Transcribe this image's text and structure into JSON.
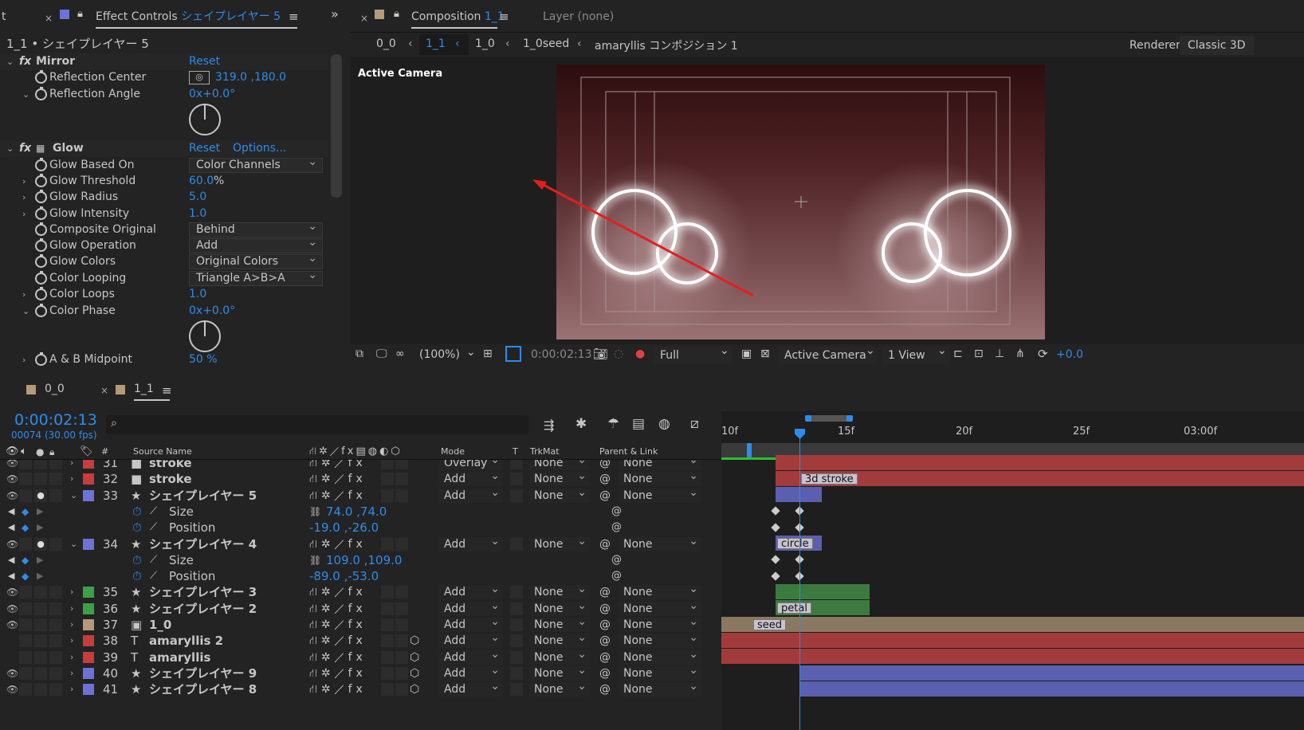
{
  "effect_controls": {
    "tab_close": "×",
    "tab_title": "Effect Controls",
    "tab_layer": "シェイプレイヤー 5",
    "layer_path": "1_1 • シェイプレイヤー 5",
    "mirror": {
      "name": "Mirror",
      "reset": "Reset",
      "props": [
        {
          "label": "Reflection Center",
          "value": "319.0 ,180.0"
        },
        {
          "label": "Reflection Angle",
          "value": "0x+0.0°"
        }
      ]
    },
    "glow": {
      "name": "Glow",
      "reset": "Reset",
      "options": "Options...",
      "props": [
        {
          "label": "Glow Based On",
          "value": "Color Channels",
          "kind": "dropdown"
        },
        {
          "label": "Glow Threshold",
          "value": "60.0",
          "unit": "%",
          "kind": "num"
        },
        {
          "label": "Glow Radius",
          "value": "5.0",
          "kind": "num"
        },
        {
          "label": "Glow Intensity",
          "value": "1.0",
          "kind": "num"
        },
        {
          "label": "Composite Original",
          "value": "Behind",
          "kind": "dropdown"
        },
        {
          "label": "Glow Operation",
          "value": "Add",
          "kind": "dropdown"
        },
        {
          "label": "Glow Colors",
          "value": "Original Colors",
          "kind": "dropdown"
        },
        {
          "label": "Color Looping",
          "value": "Triangle A>B>A",
          "kind": "dropdown"
        },
        {
          "label": "Color Loops",
          "value": "1.0",
          "kind": "num"
        },
        {
          "label": "Color Phase",
          "value": "0x+0.0°",
          "kind": "num"
        },
        {
          "label": "A & B Midpoint",
          "value": "50 %",
          "kind": "num"
        }
      ]
    }
  },
  "composition": {
    "tab_close": "×",
    "tab_title": "Composition",
    "tab_name": "1_1",
    "layer_tab": "Layer (none)",
    "breadcrumbs": [
      "0_0",
      "1_1",
      "1_0",
      "1_0seed",
      "amaryllis コンポジション 1"
    ],
    "renderer_label": "Renderer:",
    "renderer_value": "Classic 3D",
    "view_label": "Active Camera",
    "footer": {
      "zoom": "(100%)",
      "timecode": "0:00:02:13",
      "resolution": "Full",
      "camera": "Active Camera",
      "views": "1 View",
      "exposure": "+0.0"
    }
  },
  "timeline": {
    "tabs": [
      {
        "label": "0_0"
      },
      {
        "label": "1_1"
      }
    ],
    "tab_close": "×",
    "timecode": "0:00:02:13",
    "frame_info": "00074 (30.00 fps)",
    "search_placeholder": "",
    "col_headers": {
      "num": "#",
      "source": "Source Name",
      "mode": "Mode",
      "t": "T",
      "trkmat": "TrkMat",
      "parent": "Parent & Link"
    },
    "ruler": [
      "10f",
      "15f",
      "20f",
      "25f",
      "03:00f"
    ],
    "layers": [
      {
        "num": "31",
        "color": "#c83c3c",
        "icon": "■",
        "name": "stroke",
        "mode": "Overlay",
        "trk": "None",
        "parent": "None"
      },
      {
        "num": "32",
        "color": "#c83c3c",
        "icon": "■",
        "name": "stroke",
        "mode": "Add",
        "trk": "None",
        "parent": "None"
      },
      {
        "num": "33",
        "color": "#6c72d8",
        "icon": "★",
        "name": "シェイプレイヤー 5",
        "mode": "Add",
        "trk": "None",
        "parent": "None"
      },
      {
        "sub": true,
        "name": "Size",
        "value": "74.0 ,74.0"
      },
      {
        "sub": true,
        "name": "Position",
        "value": "-19.0 ,-26.0"
      },
      {
        "num": "34",
        "color": "#6c72d8",
        "icon": "★",
        "name": "シェイプレイヤー 4",
        "mode": "Add",
        "trk": "None",
        "parent": "None"
      },
      {
        "sub": true,
        "name": "Size",
        "value": "109.0 ,109.0"
      },
      {
        "sub": true,
        "name": "Position",
        "value": "-89.0 ,-53.0"
      },
      {
        "num": "35",
        "color": "#3ca046",
        "icon": "★",
        "name": "シェイプレイヤー 3",
        "mode": "Add",
        "trk": "None",
        "parent": "None"
      },
      {
        "num": "36",
        "color": "#3ca046",
        "icon": "★",
        "name": "シェイプレイヤー 2",
        "mode": "Add",
        "trk": "None",
        "parent": "None"
      },
      {
        "num": "37",
        "color": "#b49a78",
        "icon": "▣",
        "name": "1_0",
        "mode": "Add",
        "trk": "None",
        "parent": "None"
      },
      {
        "num": "38",
        "color": "#c83c3c",
        "icon": "T",
        "name": "amaryllis 2",
        "mode": "Add",
        "trk": "None",
        "parent": "None"
      },
      {
        "num": "39",
        "color": "#c83c3c",
        "icon": "T",
        "name": "amaryllis",
        "mode": "Add",
        "trk": "None",
        "parent": "None"
      },
      {
        "num": "40",
        "color": "#6c72d8",
        "icon": "★",
        "name": "シェイプレイヤー 9",
        "mode": "Add",
        "trk": "None",
        "parent": "None"
      },
      {
        "num": "41",
        "color": "#6c72d8",
        "icon": "★",
        "name": "シェイプレイヤー 8",
        "mode": "Add",
        "trk": "None",
        "parent": "None"
      }
    ],
    "bar_labels": {
      "stroke": "3d stroke",
      "circle": "circle",
      "petal": "petal",
      "seed": "seed"
    }
  },
  "colors": {
    "accent": "#2d8ceb",
    "bar_red": "#a23c3c",
    "bar_purple": "#5a5fb0",
    "bar_green": "#3c7a40",
    "bar_tan": "#8a7860"
  }
}
